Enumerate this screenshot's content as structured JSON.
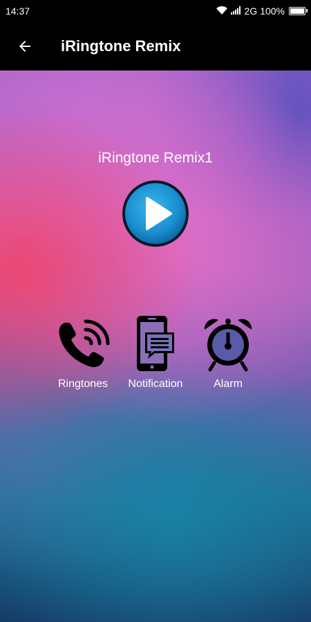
{
  "status_bar": {
    "time": "14:37",
    "network": "2G",
    "battery": "100%",
    "battery_level": 1.0,
    "icons": [
      "wifi-icon",
      "signal-icon",
      "battery-icon"
    ]
  },
  "toolbar": {
    "back_icon": "arrow-left-icon",
    "title": "iRingtone Remix"
  },
  "player": {
    "track_title": "iRingtone Remix1",
    "play_icon": "play-icon"
  },
  "actions": [
    {
      "label": "Ringtones",
      "icon": "phone-ringing-icon"
    },
    {
      "label": "Notification",
      "icon": "phone-message-icon"
    },
    {
      "label": "Alarm",
      "icon": "alarm-clock-icon"
    }
  ],
  "colors": {
    "bar_background": "#000000",
    "text": "#ffffff",
    "play_button": "#1a8fd0"
  }
}
